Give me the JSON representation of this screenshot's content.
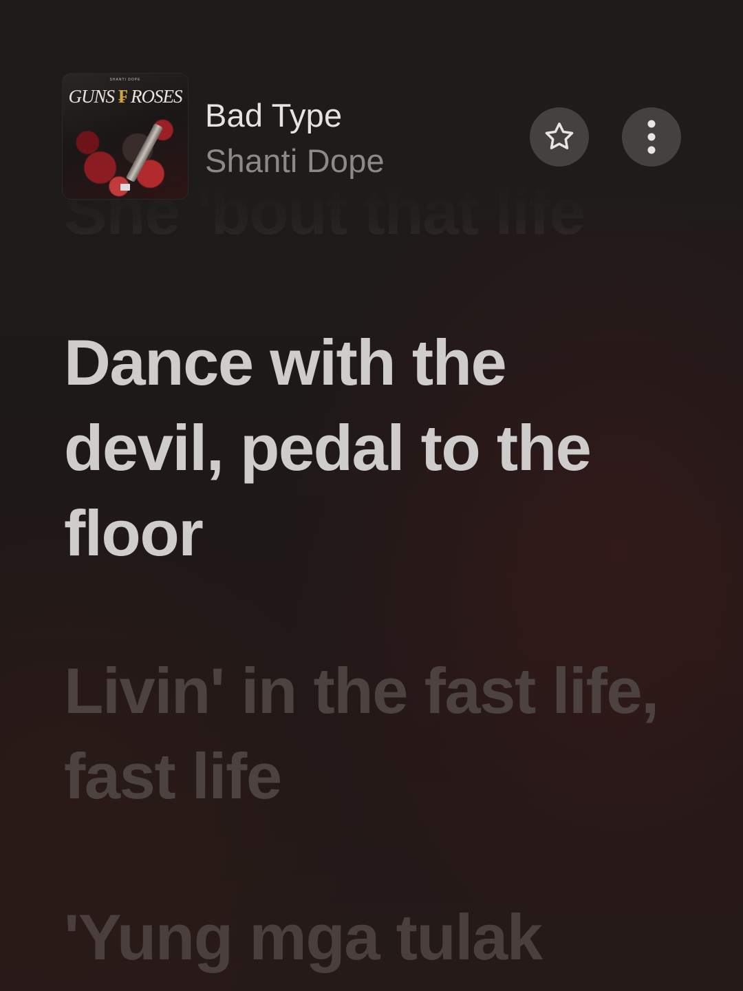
{
  "now_playing": {
    "title": "Bad Type",
    "artist": "Shanti Dope",
    "artwork": {
      "small_text": "SHANTI DOPE",
      "title_left": "GUNS",
      "title_mark": "₣",
      "title_right": "ROSES"
    }
  },
  "actions": {
    "favorite_icon": "star-outline-icon",
    "more_icon": "vertical-ellipsis-icon"
  },
  "lyrics": {
    "previous": "She 'bout that life",
    "current": "Dance with the devil, pedal to the floor",
    "next": "Livin' in the fast life, fast life",
    "after": "'Yung mga tulak"
  },
  "colors": {
    "current_lyric": "#cfcdcb",
    "upcoming_lyric": "#4c4240",
    "title": "#e6e4e2",
    "artist": "#8c8987"
  }
}
